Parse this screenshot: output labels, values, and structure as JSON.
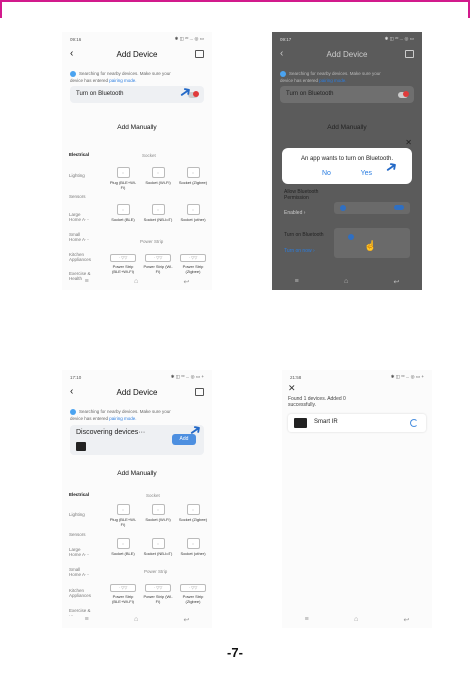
{
  "s1": {
    "time": "09:16",
    "status_icons": "✱ ◫ ᵛᵒ ... ◎ ▭",
    "header_title": "Add Device",
    "back_icon": "chevron-left-icon",
    "hint_line1": "Searching for nearby devices. Make sure your",
    "hint_line2_pre": "device has entered ",
    "hint_link": "pairing mode.",
    "bt_label": "Turn on Bluetooth",
    "manual_title": "Add Manually",
    "cat_electrical": "Electrical",
    "cat_lighting": "Lighting",
    "cat_sensors": "Sensors",
    "cat_large": "Large Home A···",
    "cat_small": "Small Home A···",
    "cat_kitchen": "Kitchen Appliances",
    "cat_exercise": "Exercise & Health",
    "sub_socket": "Socket",
    "sub_powerstrip": "Power Strip",
    "dev_plug": "Plug (BLE+Wi-Fi)",
    "dev_socket_wifi": "Socket (Wi-Fi)",
    "dev_socket_zigbee": "Socket (Zigbee)",
    "dev_socket_ble": "Socket (BLE)",
    "dev_socket_nb": "Socket (NB-IoT)",
    "dev_socket_other": "Socket (other)",
    "dev_ps_ble": "Power Strip (BLE+Wi-Fi)",
    "dev_ps_wifi": "Power Strip (Wi-Fi)",
    "dev_ps_zigbee": "Power Strip (Zigbee)",
    "nav_menu": "≡",
    "nav_home": "⌂",
    "nav_back": "↩"
  },
  "s2": {
    "time": "09:17",
    "status_icons": "✱ ◫ ᵛᵒ ... ◎ ▭",
    "header_title": "Add Device",
    "hint_line1": "Searching for nearby devices. Make sure your",
    "hint_line2_pre": "device has entered ",
    "hint_link": "pairing mode.",
    "bt_label": "Turn on Bluetooth",
    "manual_title": "Add Manually",
    "dialog_text": "An app wants to turn on Bluetooth.",
    "dialog_no": "No",
    "dialog_yes": "Yes",
    "perm_title": "Allow Bluetooth Permission",
    "perm_status": "Enabled ›",
    "turnon_title": "Turn on Bluetooth",
    "turnon_link": "Turn on now ›",
    "close_icon": "✕",
    "nav_menu": "≡",
    "nav_home": "⌂",
    "nav_back": "↩"
  },
  "s3": {
    "time": "17:10",
    "status_icons": "✱ ◫ ᵛᵒ ... ◎ ▭ +",
    "header_title": "Add Device",
    "hint_line1": "Searching for nearby devices. Make sure your",
    "hint_line2_pre": "device has entered ",
    "hint_link": "pairing mode.",
    "discovering": "Discovering devices···",
    "add_btn": "Add",
    "manual_title": "Add Manually",
    "cat_electrical": "Electrical",
    "cat_lighting": "Lighting",
    "cat_sensors": "Sensors",
    "cat_large": "Large Home A···",
    "cat_small": "Small Home A···",
    "cat_kitchen": "Kitchen Appliances",
    "cat_exercise": "Exercise & ···",
    "sub_socket": "Socket",
    "sub_powerstrip": "Power Strip",
    "dev_plug": "Plug (BLE+Wi-Fi)",
    "dev_socket_wifi": "Socket (Wi-Fi)",
    "dev_socket_zigbee": "Socket (Zigbee)",
    "dev_socket_ble": "Socket (BLE)",
    "dev_socket_nb": "Socket (NB-IoT)",
    "dev_socket_other": "Socket (other)",
    "dev_ps_ble": "Power Strip (BLE+Wi-Fi)",
    "dev_ps_wifi": "Power Strip (Wi-Fi)",
    "dev_ps_zigbee": "Power Strip (Zigbee)",
    "nav_menu": "≡",
    "nav_home": "⌂",
    "nav_back": "↩"
  },
  "s4": {
    "time": "21:58",
    "status_icons": "✱ ◫ ᵛᵒ ... ◎ ▭ +",
    "close_icon": "✕",
    "found_text": "Found 1 devices. Added 0 successfully.",
    "device_name": "Smart IR",
    "nav_menu": "≡",
    "nav_home": "⌂",
    "nav_back": "↩"
  },
  "page_number": "-7-",
  "colors": {
    "accent": "#2a7de1",
    "frame": "#d21a8c",
    "dark_screen": "#5b5b5b"
  }
}
